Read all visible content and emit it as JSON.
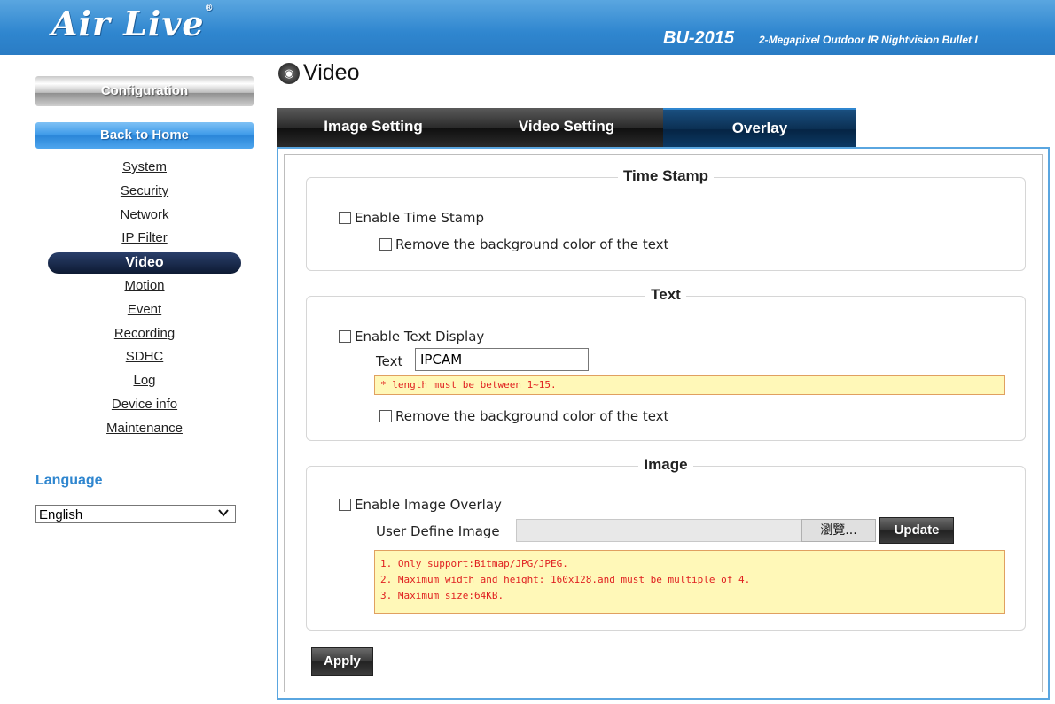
{
  "header": {
    "logo": "Air Live",
    "logo_mark": "®",
    "model": "BU-2015",
    "model_desc": "2-Megapixel Outdoor IR Nightvision Bullet I"
  },
  "sidebar": {
    "config_label": "Configuration",
    "home_label": "Back to Home",
    "items": [
      {
        "label": "System"
      },
      {
        "label": "Security"
      },
      {
        "label": "Network"
      },
      {
        "label": "IP Filter"
      },
      {
        "label": "Video",
        "active": true
      },
      {
        "label": "Motion"
      },
      {
        "label": "Event"
      },
      {
        "label": "Recording"
      },
      {
        "label": "SDHC"
      },
      {
        "label": "Log"
      },
      {
        "label": "Device info"
      },
      {
        "label": "Maintenance"
      }
    ],
    "language_label": "Language",
    "language_value": "English"
  },
  "page": {
    "title": "Video",
    "tabs": [
      {
        "label": "Image Setting",
        "active": false
      },
      {
        "label": "Video Setting",
        "active": false
      },
      {
        "label": "Overlay",
        "active": true
      }
    ]
  },
  "time_stamp": {
    "legend": "Time Stamp",
    "enable_label": "Enable Time Stamp",
    "enable_checked": false,
    "remove_bg_label": "Remove the background color of the text",
    "remove_bg_checked": false
  },
  "text_section": {
    "legend": "Text",
    "enable_label": "Enable Text Display",
    "enable_checked": false,
    "text_label": "Text",
    "text_value": "IPCAM",
    "note": "* length must be between 1~15.",
    "remove_bg_label": "Remove the background color of the text",
    "remove_bg_checked": false
  },
  "image_section": {
    "legend": "Image",
    "enable_label": "Enable Image Overlay",
    "enable_checked": false,
    "user_image_label": "User Define Image",
    "browse_label": "瀏覽...",
    "update_label": "Update",
    "notes": [
      "1. Only support:Bitmap/JPG/JPEG.",
      "2. Maximum width and height: 160x128.and must be multiple of 4.",
      "3. Maximum size:64KB."
    ]
  },
  "apply_label": "Apply"
}
